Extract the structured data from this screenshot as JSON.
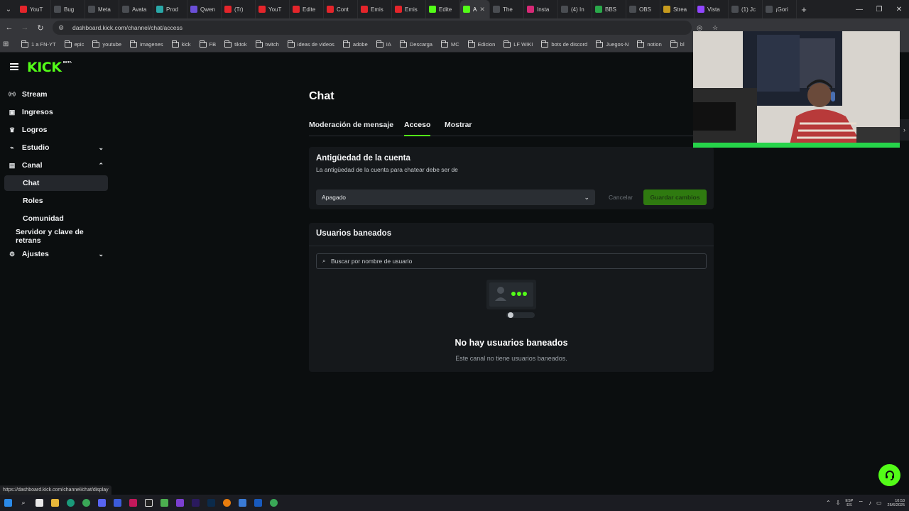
{
  "browser": {
    "tabs": [
      {
        "label": "YouT",
        "color": "#e4252b",
        "icon": "youtube-icon"
      },
      {
        "label": "Bug",
        "color": "#4a4d52",
        "icon": "bug-icon"
      },
      {
        "label": "Meta",
        "color": "#4a4d52",
        "icon": "meta-icon"
      },
      {
        "label": "Avata",
        "color": "#4a4d52",
        "icon": "avatar-site-icon"
      },
      {
        "label": "Prod",
        "color": "#2aa8a8",
        "icon": "product-icon"
      },
      {
        "label": "Qwen",
        "color": "#6b4fd8",
        "icon": "qwen-icon"
      },
      {
        "label": "(Tr)",
        "color": "#e4252b",
        "icon": "youtube-icon"
      },
      {
        "label": "YouT",
        "color": "#e4252b",
        "icon": "youtube-icon"
      },
      {
        "label": "Edite",
        "color": "#e4252b",
        "icon": "youtube-icon"
      },
      {
        "label": "Cont",
        "color": "#e4252b",
        "icon": "youtube-icon"
      },
      {
        "label": "Emis",
        "color": "#e4252b",
        "icon": "youtube-icon"
      },
      {
        "label": "Emis",
        "color": "#e4252b",
        "icon": "youtube-icon"
      },
      {
        "label": "Edite",
        "color": "#53fc18",
        "icon": "kick-icon"
      },
      {
        "label": "A",
        "color": "#53fc18",
        "icon": "kick-icon",
        "active": true
      },
      {
        "label": "The",
        "color": "#4a4d52",
        "icon": "site-icon"
      },
      {
        "label": "Insta",
        "color": "#d62976",
        "icon": "instagram-icon"
      },
      {
        "label": "(4) In",
        "color": "#4a4d52",
        "icon": "threads-icon"
      },
      {
        "label": "BBS",
        "color": "#2aa84a",
        "icon": "chatgpt-icon"
      },
      {
        "label": "OBS",
        "color": "#4a4d52",
        "icon": "obs-icon"
      },
      {
        "label": "Strea",
        "color": "#c79b1e",
        "icon": "stream-icon"
      },
      {
        "label": "Vista",
        "color": "#9146ff",
        "icon": "twitch-icon"
      },
      {
        "label": "(1) Jc",
        "color": "#4a4d52",
        "icon": "x-icon"
      },
      {
        "label": "¡Gori",
        "color": "#4a4d52",
        "icon": "site-icon"
      }
    ],
    "url": "dashboard.kick.com/channel/chat/access",
    "bookmarks": [
      "1 a FN-YT",
      "epic",
      "youtube",
      "imagenes",
      "kick",
      "FB",
      "tiktok",
      "twitch",
      "ideas de videos",
      "adobe",
      "IA",
      "Descarga",
      "MC",
      "Edicion",
      "LF WIKI",
      "bots de discord",
      "Juegos-N",
      "notion",
      "bl"
    ],
    "status_link": "https://dashboard.kick.com/channel/chat/display"
  },
  "sidebar": {
    "logo": "KICK",
    "logo_badge": "BETA",
    "items": [
      {
        "label": "Stream",
        "icon": "broadcast-icon",
        "name": "sidebar-item-stream"
      },
      {
        "label": "Ingresos",
        "icon": "wallet-icon",
        "name": "sidebar-item-ingresos"
      },
      {
        "label": "Logros",
        "icon": "trophy-icon",
        "name": "sidebar-item-logros"
      },
      {
        "label": "Estudio",
        "icon": "studio-icon",
        "name": "sidebar-item-estudio",
        "chevron": "down"
      },
      {
        "label": "Canal",
        "icon": "channel-icon",
        "name": "sidebar-item-canal",
        "chevron": "up"
      },
      {
        "label": "Chat",
        "name": "sidebar-item-chat",
        "sub": true,
        "selected": true
      },
      {
        "label": "Roles",
        "name": "sidebar-item-roles",
        "sub": true
      },
      {
        "label": "Comunidad",
        "name": "sidebar-item-comunidad",
        "sub": true
      },
      {
        "label": "Servidor y clave de retrans",
        "name": "sidebar-item-servidor",
        "sub": true,
        "indent": "small"
      },
      {
        "label": "Ajustes",
        "icon": "gear-icon",
        "name": "sidebar-item-ajustes",
        "chevron": "down"
      }
    ]
  },
  "main": {
    "title": "Chat",
    "tabs": [
      "Moderación de mensaje",
      "Acceso",
      "Mostrar"
    ],
    "active_tab": "Acceso",
    "account_age": {
      "title": "Antigüedad de la cuenta",
      "subtitle": "La antigüedad de la cuenta para chatear debe ser de",
      "selected": "Apagado",
      "cancel": "Cancelar",
      "save": "Guardar cambios"
    },
    "banned": {
      "title": "Usuarios baneados",
      "search_placeholder": "Buscar por nombre de usuario",
      "empty_title": "No hay usuarios baneados",
      "empty_subtitle": "Este canal no tiene usuarios baneados."
    }
  },
  "taskbar": {
    "lang_top": "ESP",
    "lang_bottom": "ES",
    "time": "10:53",
    "date": "25/6/2025"
  },
  "colors": {
    "accent": "#53fc18",
    "background": "#0b0e0f",
    "card": "#15181b",
    "save_button": "#2f7a10"
  }
}
